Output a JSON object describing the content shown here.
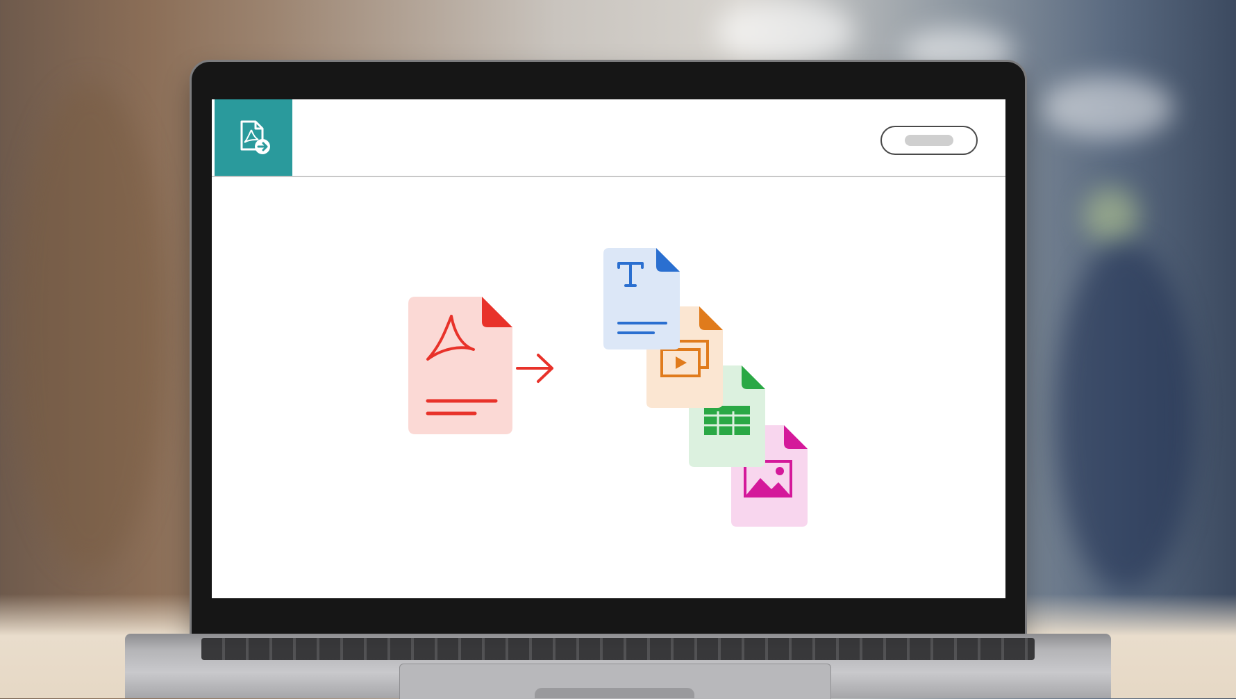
{
  "app": {
    "logo_icon": "pdf-convert-icon",
    "accent_color": "#2a9a9c"
  },
  "illustration": {
    "source": {
      "icon": "pdf-file-icon",
      "color": "#e8322a",
      "bg": "#fbd9d5"
    },
    "arrow": {
      "icon": "arrow-right-icon",
      "color": "#e8322a"
    },
    "outputs": [
      {
        "name": "text-file-icon",
        "color": "#2a6fd0",
        "bg": "#dce7f7"
      },
      {
        "name": "presentation-file-icon",
        "color": "#e07b1c",
        "bg": "#fbe6d2"
      },
      {
        "name": "spreadsheet-file-icon",
        "color": "#2aa845",
        "bg": "#dcf1df"
      },
      {
        "name": "image-file-icon",
        "color": "#d4199a",
        "bg": "#f8d6ee"
      }
    ]
  }
}
